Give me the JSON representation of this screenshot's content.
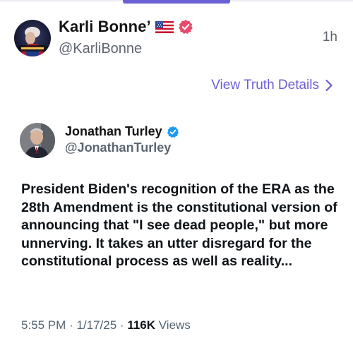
{
  "post": {
    "author_name": "Karli Bonne’",
    "author_handle": "@KarliBonne",
    "time_ago": "1h",
    "flag_icon": "us-flag-icon",
    "verified_icon": "verified-badge-icon",
    "details_link": "View Truth Details"
  },
  "embedded_post": {
    "author_name": "Jonathan Turley",
    "author_handle": "@JonathanTurley",
    "body": "President Biden's recognition of the ERA as the 28th Amendment is the constitutional version of announcing that \"I see dead people,\" but more unnerving. It takes an utter disregard for the constitutional process as well as reality...",
    "time": "5:55 PM",
    "date": "1/17/25",
    "views_count": "116K",
    "views_label": "Views",
    "separator": "·"
  },
  "colors": {
    "accent": "#6b5fd6",
    "verified_main": "#e74b6b",
    "verified_x": "#1d9bf0",
    "muted_text": "#5f6470"
  }
}
